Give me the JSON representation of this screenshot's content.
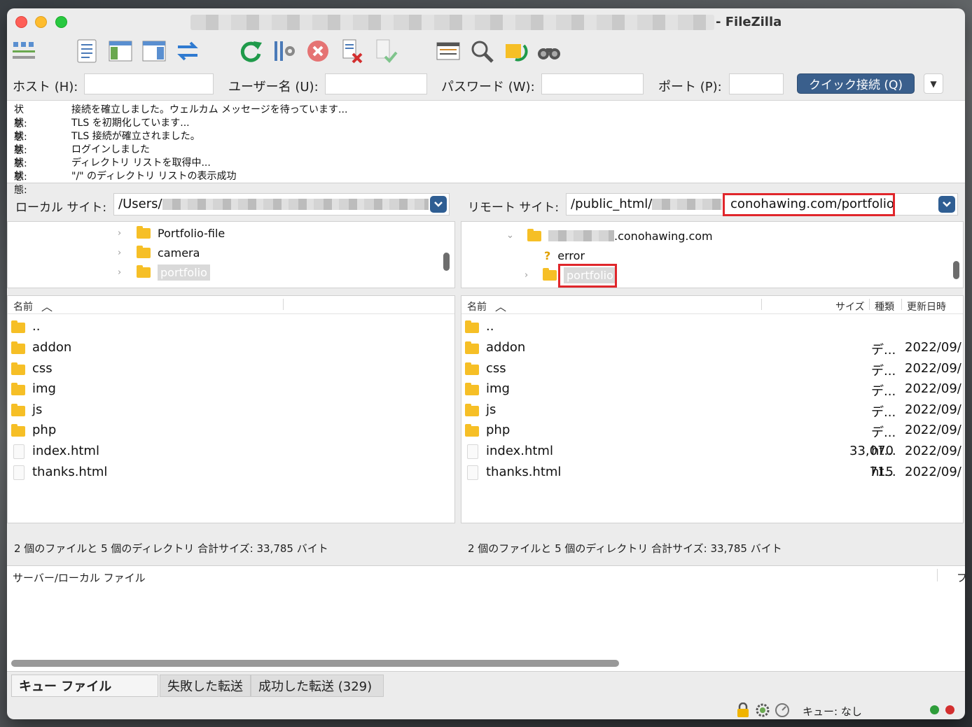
{
  "window": {
    "title": "- FileZilla"
  },
  "quickconnect": {
    "host_label": "ホスト (H):",
    "user_label": "ユーザー名 (U):",
    "password_label": "パスワード (W):",
    "port_label": "ポート (P):",
    "connect_label": "クイック接続 (Q)"
  },
  "log": [
    {
      "key": "状態:",
      "msg": "接続を確立しました。ウェルカム メッセージを待っています..."
    },
    {
      "key": "状態:",
      "msg": "TLS を初期化しています..."
    },
    {
      "key": "状態:",
      "msg": "TLS 接続が確立されました。"
    },
    {
      "key": "状態:",
      "msg": "ログインしました"
    },
    {
      "key": "状態:",
      "msg": "ディレクトリ リストを取得中..."
    },
    {
      "key": "状態:",
      "msg": "\"/\" のディレクトリ リストの表示成功"
    }
  ],
  "local": {
    "label": "ローカル サイト:",
    "path": "/Users/",
    "tree": [
      "Portfolio-file",
      "camera",
      "portfolio"
    ],
    "header_name": "名前",
    "files": [
      {
        "name": ".."
      },
      {
        "name": "addon"
      },
      {
        "name": "css"
      },
      {
        "name": "img"
      },
      {
        "name": "js"
      },
      {
        "name": "php"
      },
      {
        "name": "index.html"
      },
      {
        "name": "thanks.html"
      }
    ],
    "summary": "2 個のファイルと 5 個のディレクトリ 合計サイズ: 33,785 バイト"
  },
  "remote": {
    "label": "リモート サイト:",
    "path_prefix": "/public_html/",
    "path_suffix": "conohawing.com/portfolio",
    "tree": [
      ".conohawing.com",
      "error",
      "portfolio"
    ],
    "header_name": "名前",
    "header_size": "サイズ",
    "header_type": "種類",
    "header_modified": "更新日時",
    "files": [
      {
        "name": "..",
        "size": "",
        "type": "",
        "modified": ""
      },
      {
        "name": "addon",
        "size": "",
        "type": "デ...",
        "modified": "2022/09/"
      },
      {
        "name": "css",
        "size": "",
        "type": "デ...",
        "modified": "2022/09/"
      },
      {
        "name": "img",
        "size": "",
        "type": "デ...",
        "modified": "2022/09/"
      },
      {
        "name": "js",
        "size": "",
        "type": "デ...",
        "modified": "2022/09/"
      },
      {
        "name": "php",
        "size": "",
        "type": "デ...",
        "modified": "2022/09/"
      },
      {
        "name": "index.html",
        "size": "33,070",
        "type": "ht...",
        "modified": "2022/09/"
      },
      {
        "name": "thanks.html",
        "size": "715",
        "type": "ht...",
        "modified": "2022/09/"
      }
    ],
    "summary": "2 個のファイルと 5 個のディレクトリ 合計サイズ: 33,785 バイト"
  },
  "queue": {
    "header": "サーバー/ローカル ファイル",
    "header_right": "フ",
    "tabs": [
      "キュー ファイル",
      "失敗した転送",
      "成功した転送 (329)"
    ]
  },
  "status": {
    "queue_text": "キュー: なし"
  },
  "colors": {
    "highlight": "#e0262b",
    "accent": "#3a5f8c",
    "folder": "#f6bf26"
  }
}
